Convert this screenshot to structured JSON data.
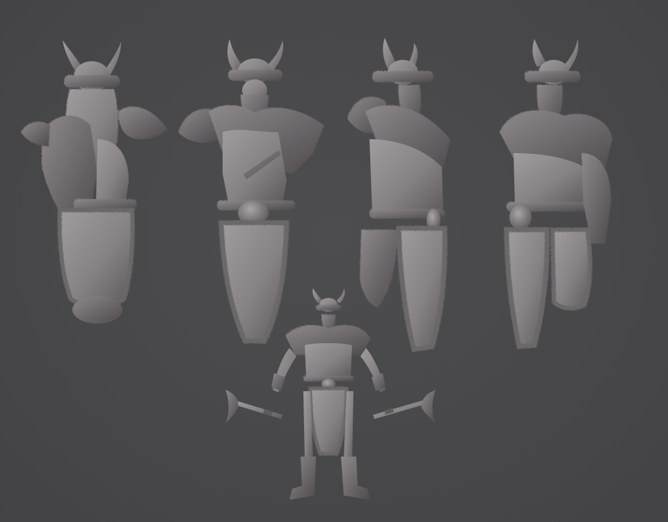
{
  "scene": {
    "background_color": "#49494b",
    "sculpt_color": "#8a8587",
    "views": [
      "back",
      "front",
      "three-quarter-left",
      "three-quarter-right",
      "full-body-front"
    ],
    "props": [
      "axe",
      "axe"
    ]
  }
}
